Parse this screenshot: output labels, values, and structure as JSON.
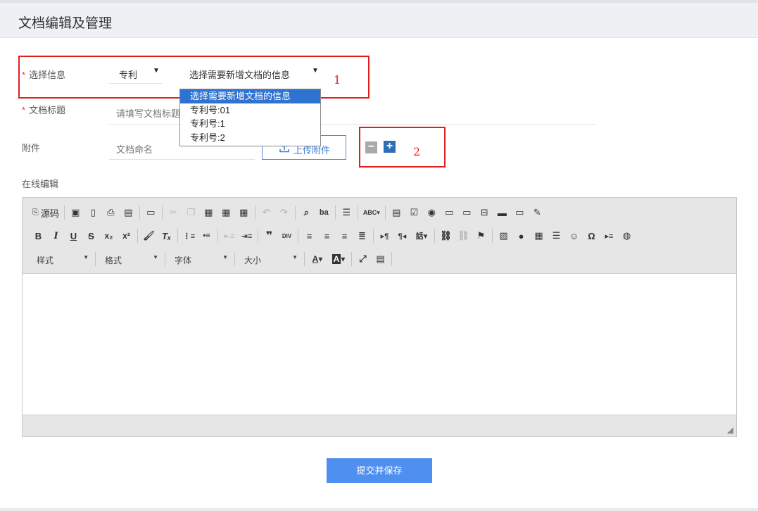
{
  "header": {
    "title": "文档编辑及管理"
  },
  "form": {
    "required_mark": "*",
    "select_info_label": "选择信息",
    "type_select_value": "专利",
    "doc_select_value": "选择需要新增文档的信息",
    "doc_title_label": "文档标题",
    "doc_title_placeholder": "请填写文档标题",
    "attachment_label": "附件",
    "attachment_name_placeholder": "文档命名",
    "upload_button": "上传附件",
    "online_edit_label": "在线编辑"
  },
  "dropdown": {
    "options": [
      {
        "label": "选择需要新增文档的信息",
        "selected": true
      },
      {
        "label": "专利号:01",
        "selected": false
      },
      {
        "label": "专利号:1",
        "selected": false
      },
      {
        "label": "专利号:2",
        "selected": false
      }
    ]
  },
  "annotations": {
    "box1_number": "1",
    "box2_number": "2"
  },
  "colors": {
    "accent": "#4f8ff0",
    "annotation": "#e02020",
    "minus": "#a9a9a9",
    "plus": "#2f6fb5"
  },
  "editor": {
    "source_label": "源码",
    "styles_combo": "样式",
    "format_combo": "格式",
    "font_combo": "字体",
    "size_combo": "大小",
    "icons": {
      "row1": [
        "source-icon",
        "save-icon",
        "new-page-icon",
        "preview-icon",
        "print-icon",
        "templates-icon",
        "cut-icon",
        "copy-icon",
        "paste-icon",
        "paste-text-icon",
        "paste-word-icon",
        "undo-icon",
        "redo-icon",
        "find-icon",
        "replace-icon",
        "select-all-icon",
        "spellcheck-icon",
        "form-icon",
        "checkbox-icon",
        "radio-icon",
        "textfield-icon",
        "textarea-icon",
        "select-icon",
        "button-icon",
        "image-button-icon",
        "hidden-field-icon"
      ],
      "row2": [
        "bold-icon",
        "italic-icon",
        "underline-icon",
        "strike-icon",
        "subscript-icon",
        "superscript-icon",
        "copy-format-icon",
        "remove-format-icon",
        "numbered-list-icon",
        "bulleted-list-icon",
        "outdent-icon",
        "indent-icon",
        "blockquote-icon",
        "div-icon",
        "align-left-icon",
        "align-center-icon",
        "align-right-icon",
        "justify-icon",
        "ltr-icon",
        "rtl-icon",
        "language-icon",
        "link-icon",
        "unlink-icon",
        "anchor-icon",
        "image-icon",
        "flash-icon",
        "table-icon",
        "horizontal-rule-icon",
        "smiley-icon",
        "special-char-icon",
        "page-break-icon",
        "iframe-icon"
      ],
      "row3": [
        "text-color-icon",
        "bg-color-icon",
        "maximize-icon",
        "show-blocks-icon"
      ]
    }
  },
  "submit_button": "提交并保存"
}
